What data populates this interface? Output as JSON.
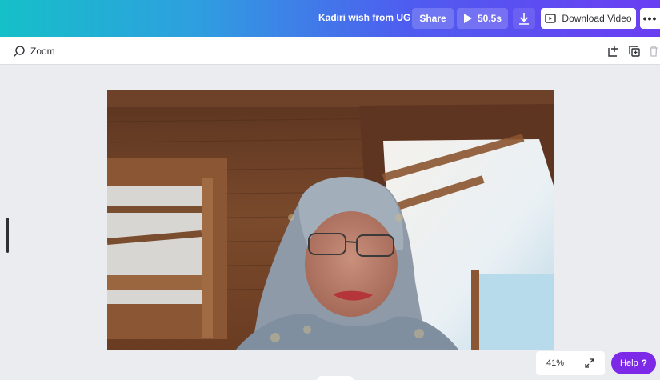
{
  "header": {
    "doc_title": "Kadiri wish from UG",
    "share_label": "Share",
    "play_duration": "50.5s",
    "download_video_label": "Download Video",
    "more_label": "•••"
  },
  "toolbar": {
    "zoom_label": "Zoom"
  },
  "footer": {
    "zoom_level": "41%",
    "help_label": "Help",
    "help_mark": "?"
  },
  "colors": {
    "brand_gradient_start": "#15c0c8",
    "brand_gradient_end": "#6a3ef2",
    "help_purple": "#7d2ae8"
  }
}
